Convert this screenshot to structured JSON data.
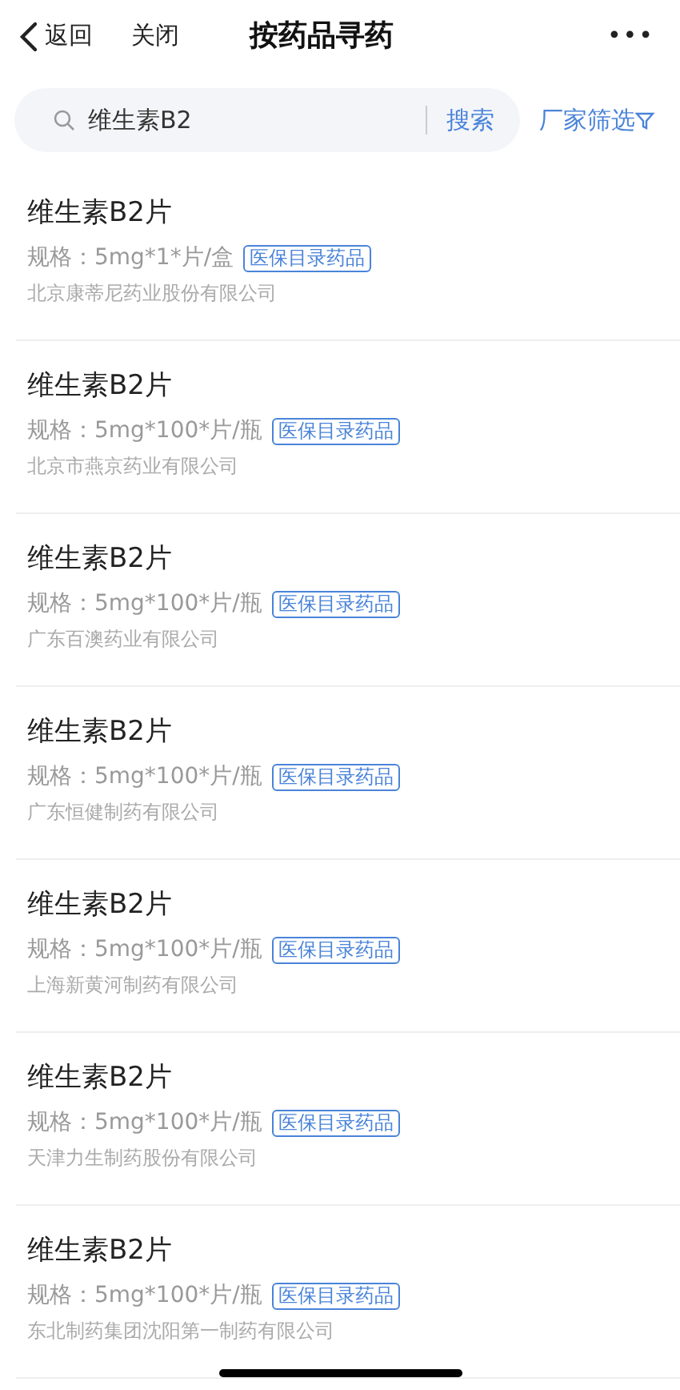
{
  "nav": {
    "back": "返回",
    "close": "关闭",
    "title": "按药品寻药",
    "more": "•••"
  },
  "search": {
    "value": "维生素B2",
    "button": "搜索",
    "filter": "厂家筛选"
  },
  "items": [
    {
      "name": "维生素B2片",
      "spec": "规格：5mg*1*片/盒",
      "tag": "医保目录药品",
      "maker": "北京康蒂尼药业股份有限公司"
    },
    {
      "name": "维生素B2片",
      "spec": "规格：5mg*100*片/瓶",
      "tag": "医保目录药品",
      "maker": "北京市燕京药业有限公司"
    },
    {
      "name": "维生素B2片",
      "spec": "规格：5mg*100*片/瓶",
      "tag": "医保目录药品",
      "maker": "广东百澳药业有限公司"
    },
    {
      "name": "维生素B2片",
      "spec": "规格：5mg*100*片/瓶",
      "tag": "医保目录药品",
      "maker": "广东恒健制药有限公司"
    },
    {
      "name": "维生素B2片",
      "spec": "规格：5mg*100*片/瓶",
      "tag": "医保目录药品",
      "maker": "上海新黄河制药有限公司"
    },
    {
      "name": "维生素B2片",
      "spec": "规格：5mg*100*片/瓶",
      "tag": "医保目录药品",
      "maker": "天津力生制药股份有限公司"
    },
    {
      "name": "维生素B2片",
      "spec": "规格：5mg*100*片/瓶",
      "tag": "医保目录药品",
      "maker": "东北制药集团沈阳第一制药有限公司"
    }
  ]
}
